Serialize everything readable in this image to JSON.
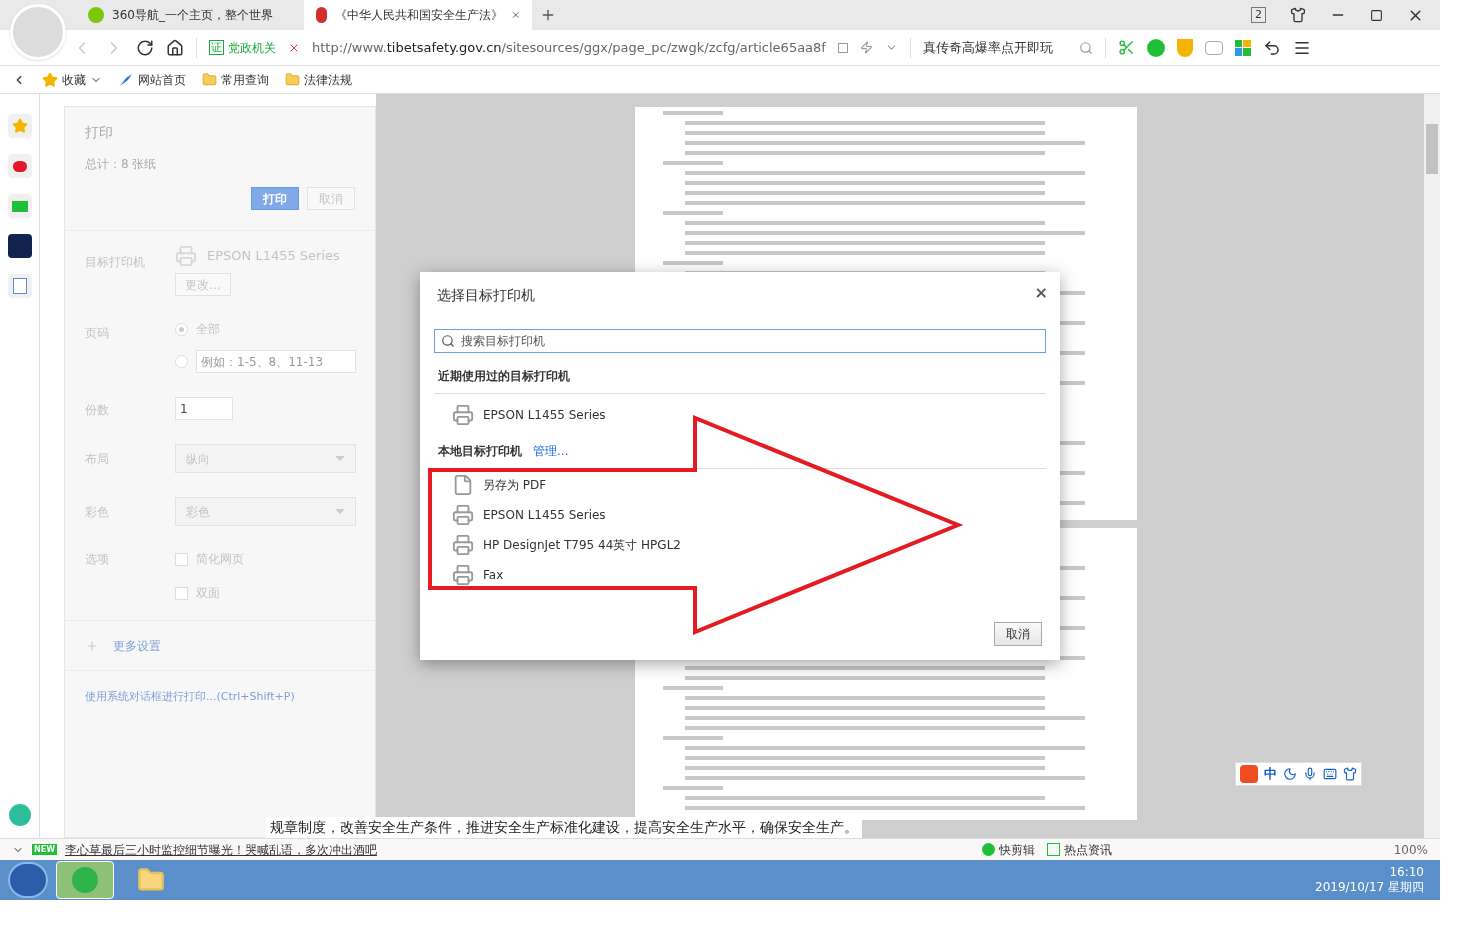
{
  "browser": {
    "tabs": [
      {
        "label": "360导航_一个主页，整个世界",
        "selected": false
      },
      {
        "label": "《中华人民共和国安全生产法》",
        "selected": true
      }
    ],
    "tab_count": "2",
    "address_bar": {
      "site_badge": "证",
      "site_label": "党政机关",
      "url_prefix": "http://www.",
      "url_domain": "tibetsafety.gov.cn",
      "url_path": "/sitesources/ggx/page_pc/zwgk/zcfg/article65aa8f"
    },
    "search_box": {
      "value": "真传奇高爆率点开即玩"
    },
    "bookmarks": [
      {
        "label": "收藏",
        "kind": "favorites"
      },
      {
        "label": "网站首页",
        "kind": "site"
      },
      {
        "label": "常用查询",
        "kind": "folder"
      },
      {
        "label": "法律法规",
        "kind": "folder"
      }
    ]
  },
  "print_panel": {
    "title": "打印",
    "total": "总计：8 张纸",
    "buttons": [
      {
        "label": "打印",
        "kind": "primary"
      },
      {
        "label": "取消",
        "kind": "secondary"
      }
    ],
    "destination": {
      "label": "目标打印机",
      "printer": "EPSON L1455 Series",
      "change_button": "更改..."
    },
    "pages": {
      "label": "页码",
      "options": [
        {
          "kind": "all",
          "label": "全部",
          "selected": true
        },
        {
          "kind": "custom",
          "placeholder": "例如：1-5、8、11-13",
          "selected": false
        }
      ]
    },
    "copies": {
      "label": "份数",
      "value": "1"
    },
    "layout": {
      "label": "布局",
      "value": "纵向"
    },
    "color": {
      "label": "彩色",
      "value": "彩色"
    },
    "options": {
      "label": "选项",
      "items": [
        {
          "label": "简化网页",
          "checked": false
        },
        {
          "label": "双面",
          "checked": false
        }
      ]
    },
    "more_settings": "更多设置",
    "system_dialog_link": "使用系统对话框进行打印...(Ctrl+Shift+P)"
  },
  "preview": {
    "body_line": "规章制度，改善安全生产条件，推进安全生产标准化建设，提高安全生产水平，确保安全生产。"
  },
  "dialog": {
    "title": "选择目标打印机",
    "close": "×",
    "search": {
      "placeholder": "搜索目标打印机"
    },
    "recent": {
      "heading": "近期使用过的目标打印机",
      "printers": [
        {
          "name": "EPSON L1455 Series",
          "kind": "printer"
        }
      ]
    },
    "local": {
      "heading": "本地目标打印机",
      "manage_link": "管理...",
      "printers": [
        {
          "name": "另存为 PDF",
          "kind": "pdf"
        },
        {
          "name": "EPSON L1455 Series",
          "kind": "printer"
        },
        {
          "name": "HP DesignJet T795 44英寸 HPGL2",
          "kind": "printer"
        },
        {
          "name": "Fax",
          "kind": "printer"
        }
      ]
    },
    "cancel_button": "取消"
  },
  "ime_toolbar": {
    "mode": "中"
  },
  "status_bar": {
    "news_badge": "NEW",
    "headline": "李心草最后三小时监控细节曝光！哭喊乱语，多次冲出酒吧",
    "items": [
      "快剪辑",
      "热点资讯"
    ],
    "zoom": "100%"
  },
  "taskbar": {
    "time": "16:10",
    "date": "2019/10/17 星期四"
  }
}
